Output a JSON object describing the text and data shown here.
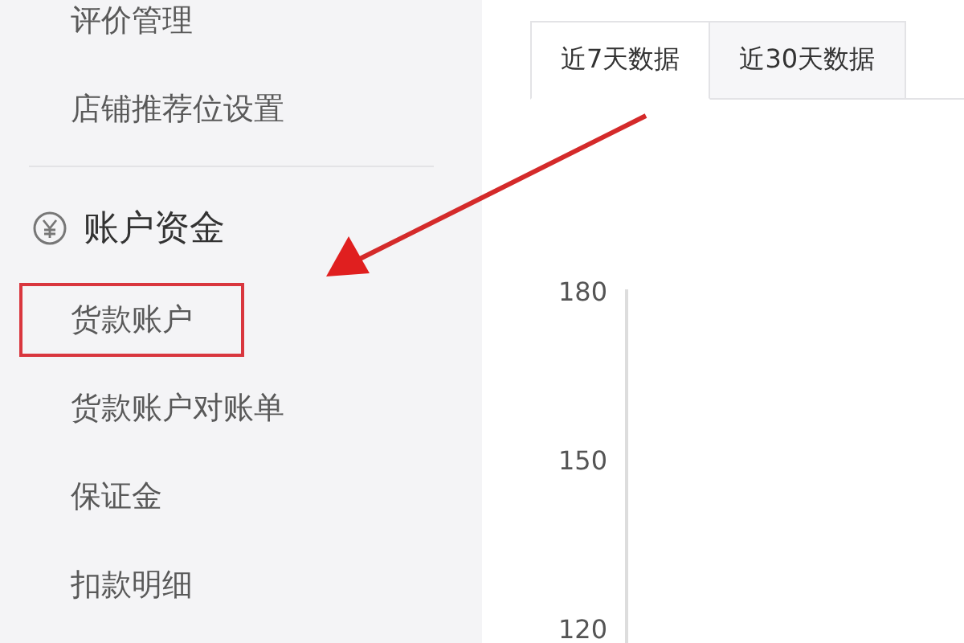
{
  "sidebar": {
    "items": [
      {
        "label": "评价管理",
        "highlighted": false
      },
      {
        "label": "店铺推荐位设置",
        "highlighted": false
      }
    ],
    "section": {
      "title": "账户资金",
      "items": [
        {
          "label": "货款账户",
          "highlighted": true
        },
        {
          "label": "货款账户对账单",
          "highlighted": false
        },
        {
          "label": "保证金",
          "highlighted": false
        },
        {
          "label": "扣款明细",
          "highlighted": false
        }
      ]
    }
  },
  "tabs": [
    {
      "label": "近7天数据",
      "selected": true
    },
    {
      "label": "近30天数据",
      "selected": false
    }
  ],
  "chart": {
    "y_ticks": [
      "180",
      "150",
      "120"
    ]
  }
}
